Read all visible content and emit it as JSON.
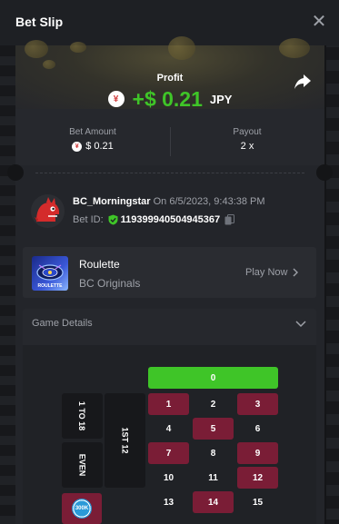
{
  "header": {
    "title": "Bet Slip",
    "close_icon": "close-icon"
  },
  "profit": {
    "label": "Profit",
    "value": "+$ 0.21",
    "currency": "JPY",
    "currency_symbol": "¥",
    "value_color": "#3fc528"
  },
  "stats": {
    "bet_amount_label": "Bet Amount",
    "bet_amount_value": "$ 0.21",
    "payout_label": "Payout",
    "payout_value": "2 x"
  },
  "bet": {
    "username": "BC_Morningstar",
    "on_text": "On 6/5/2023, 9:43:38 PM",
    "bet_id_label": "Bet ID:",
    "bet_id": "119399940504945367"
  },
  "game": {
    "thumb_label": "ROULETTE",
    "name": "Roulette",
    "provider": "BC Originals",
    "play_label": "Play Now"
  },
  "details": {
    "label": "Game Details",
    "zero": "0",
    "side_labels": [
      "1 TO 18",
      "EVEN"
    ],
    "dozen_label": "1ST 12",
    "chip_label": "300K",
    "numbers": [
      "1",
      "2",
      "3",
      "4",
      "5",
      "6",
      "7",
      "8",
      "9",
      "10",
      "11",
      "12",
      "13",
      "14",
      "15"
    ],
    "red_color": "#7a1d36",
    "green_color": "#3fc528"
  }
}
